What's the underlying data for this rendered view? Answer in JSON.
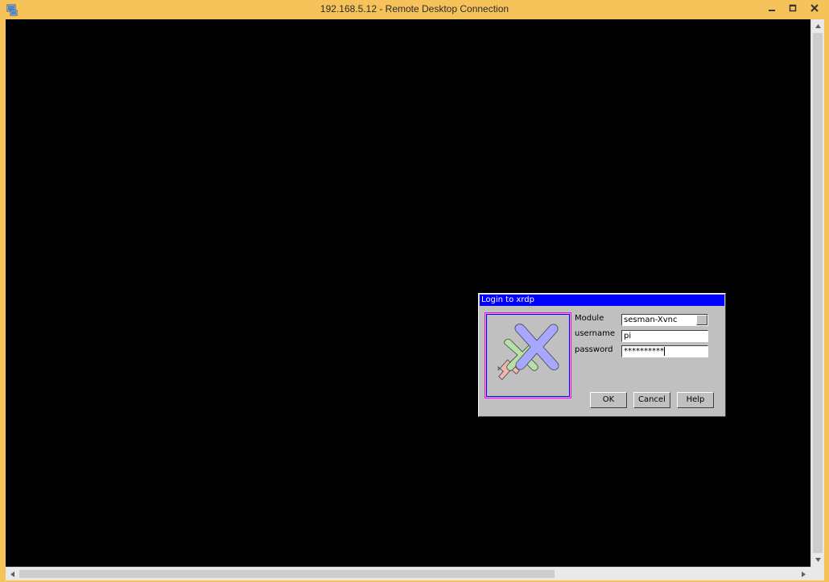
{
  "window": {
    "title": "192.168.5.12 - Remote Desktop Connection",
    "frame_color": "#f5c35a"
  },
  "remote": {
    "background": "#000000"
  },
  "dialog": {
    "title": "Login to xrdp",
    "titlebar_color": "#0000ff",
    "module": {
      "label": "Module",
      "value": "sesman-Xvnc"
    },
    "username": {
      "label": "username",
      "value": "pi"
    },
    "password": {
      "label": "password",
      "value": "**********"
    },
    "buttons": {
      "ok": "OK",
      "cancel": "Cancel",
      "help": "Help"
    }
  },
  "icons": {
    "app": "remote-desktop-icon",
    "minimize": "minimize-icon",
    "maximize": "maximize-icon",
    "close": "close-icon",
    "logo": "xrdp-logo"
  }
}
